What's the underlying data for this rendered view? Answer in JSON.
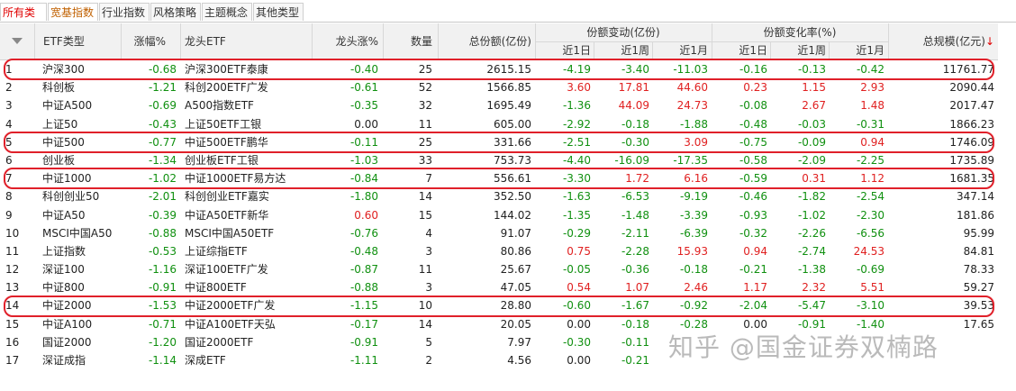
{
  "tabs": [
    {
      "label": "所有类型",
      "state": "active"
    },
    {
      "label": "宽基指数",
      "state": "selected"
    },
    {
      "label": "行业指数",
      "state": ""
    },
    {
      "label": "风格策略",
      "state": ""
    },
    {
      "label": "主题概念",
      "state": ""
    },
    {
      "label": "其他类型",
      "state": ""
    }
  ],
  "columns": {
    "etf_type": "ETF类型",
    "change_pct": "涨幅%",
    "leader_etf": "龙头ETF",
    "leader_change": "龙头涨%",
    "count": "数量",
    "total_shares": "总份额(亿份)",
    "share_change_group": "份额变动(亿份)",
    "share_rate_group": "份额变化率(%)",
    "d1": "近1日",
    "w1": "近1周",
    "m1": "近1月",
    "total_scale": "总规模(亿元)",
    "sort_indicator": "↓"
  },
  "rows": [
    {
      "no": "1",
      "type": "沪深300",
      "chg": "-0.68",
      "etf": "沪深300ETF泰康",
      "lchg": "-0.40",
      "cnt": "25",
      "shares": "2615.15",
      "sd": "-4.19",
      "sw": "-3.40",
      "sm": "-11.03",
      "rd": "-0.16",
      "rw": "-0.13",
      "rm": "-0.42",
      "scale": "11761.77"
    },
    {
      "no": "2",
      "type": "科创板",
      "chg": "-1.21",
      "etf": "科创200ETF广发",
      "lchg": "-0.61",
      "cnt": "52",
      "shares": "1566.85",
      "sd": "3.60",
      "sw": "17.81",
      "sm": "44.60",
      "rd": "0.23",
      "rw": "1.15",
      "rm": "2.93",
      "scale": "2090.44"
    },
    {
      "no": "3",
      "type": "中证A500",
      "chg": "-0.69",
      "etf": "A500指数ETF",
      "lchg": "-0.35",
      "cnt": "32",
      "shares": "1695.49",
      "sd": "-1.36",
      "sw": "44.09",
      "sm": "24.73",
      "rd": "-0.08",
      "rw": "2.67",
      "rm": "1.48",
      "scale": "2017.47"
    },
    {
      "no": "4",
      "type": "上证50",
      "chg": "-0.43",
      "etf": "上证50ETF工银",
      "lchg": "0.00",
      "cnt": "11",
      "shares": "605.00",
      "sd": "-2.92",
      "sw": "-0.18",
      "sm": "-1.88",
      "rd": "-0.48",
      "rw": "-0.03",
      "rm": "-0.31",
      "scale": "1866.23"
    },
    {
      "no": "5",
      "type": "中证500",
      "chg": "-0.77",
      "etf": "中证500ETF鹏华",
      "lchg": "-0.11",
      "cnt": "25",
      "shares": "331.66",
      "sd": "-2.51",
      "sw": "-0.30",
      "sm": "3.09",
      "rd": "-0.75",
      "rw": "-0.09",
      "rm": "0.94",
      "scale": "1746.09"
    },
    {
      "no": "6",
      "type": "创业板",
      "chg": "-1.34",
      "etf": "创业板ETF工银",
      "lchg": "-1.03",
      "cnt": "33",
      "shares": "753.73",
      "sd": "-4.40",
      "sw": "-16.09",
      "sm": "-17.35",
      "rd": "-0.58",
      "rw": "-2.09",
      "rm": "-2.25",
      "scale": "1735.89"
    },
    {
      "no": "7",
      "type": "中证1000",
      "chg": "-1.02",
      "etf": "中证1000ETF易方达",
      "lchg": "-0.84",
      "cnt": "7",
      "shares": "556.61",
      "sd": "-3.30",
      "sw": "1.72",
      "sm": "6.16",
      "rd": "-0.59",
      "rw": "0.31",
      "rm": "1.12",
      "scale": "1681.35"
    },
    {
      "no": "8",
      "type": "科创创业50",
      "chg": "-2.01",
      "etf": "科创创业ETF嘉实",
      "lchg": "-1.80",
      "cnt": "14",
      "shares": "352.50",
      "sd": "-1.63",
      "sw": "-6.53",
      "sm": "-9.19",
      "rd": "-0.46",
      "rw": "-1.82",
      "rm": "-2.54",
      "scale": "347.14"
    },
    {
      "no": "9",
      "type": "中证A50",
      "chg": "-0.39",
      "etf": "中证A50ETF新华",
      "lchg": "0.60",
      "cnt": "15",
      "shares": "144.02",
      "sd": "-1.35",
      "sw": "-1.48",
      "sm": "-3.39",
      "rd": "-0.93",
      "rw": "-1.02",
      "rm": "-2.30",
      "scale": "181.86"
    },
    {
      "no": "10",
      "type": "MSCI中国A50",
      "chg": "-0.88",
      "etf": "MSCI中国A50ETF",
      "lchg": "-0.76",
      "cnt": "4",
      "shares": "91.07",
      "sd": "-0.29",
      "sw": "-2.11",
      "sm": "-6.39",
      "rd": "-0.32",
      "rw": "-2.26",
      "rm": "-6.56",
      "scale": "95.99"
    },
    {
      "no": "11",
      "type": "上证指数",
      "chg": "-0.53",
      "etf": "上证综指ETF",
      "lchg": "-0.48",
      "cnt": "3",
      "shares": "80.86",
      "sd": "0.75",
      "sw": "-2.28",
      "sm": "15.93",
      "rd": "0.94",
      "rw": "-2.74",
      "rm": "24.53",
      "scale": "84.81"
    },
    {
      "no": "12",
      "type": "深证100",
      "chg": "-1.16",
      "etf": "深证100ETF广发",
      "lchg": "-0.87",
      "cnt": "11",
      "shares": "25.67",
      "sd": "-0.05",
      "sw": "-0.36",
      "sm": "-0.18",
      "rd": "-0.21",
      "rw": "-1.38",
      "rm": "-0.69",
      "scale": "78.33"
    },
    {
      "no": "13",
      "type": "中证800",
      "chg": "-0.91",
      "etf": "中证800ETF",
      "lchg": "-0.88",
      "cnt": "3",
      "shares": "47.05",
      "sd": "0.54",
      "sw": "1.07",
      "sm": "2.46",
      "rd": "1.17",
      "rw": "2.32",
      "rm": "5.51",
      "scale": "59.27"
    },
    {
      "no": "14",
      "type": "中证2000",
      "chg": "-1.53",
      "etf": "中证2000ETF广发",
      "lchg": "-1.15",
      "cnt": "10",
      "shares": "28.80",
      "sd": "-0.60",
      "sw": "-1.67",
      "sm": "-0.92",
      "rd": "-2.04",
      "rw": "-5.47",
      "rm": "-3.10",
      "scale": "39.53"
    },
    {
      "no": "15",
      "type": "中证A100",
      "chg": "-0.71",
      "etf": "中证A100ETF天弘",
      "lchg": "-0.17",
      "cnt": "14",
      "shares": "20.05",
      "sd": "0.00",
      "sw": "-0.18",
      "sm": "-0.28",
      "rd": "0.00",
      "rw": "-0.91",
      "rm": "-1.40",
      "scale": "17.65"
    },
    {
      "no": "16",
      "type": "国证2000",
      "chg": "-1.20",
      "etf": "国证2000ETF",
      "lchg": "-0.91",
      "cnt": "5",
      "shares": "7.97",
      "sd": "-0.30",
      "sw": "-0.11",
      "sm": "",
      "rd": "",
      "rw": "",
      "rm": "",
      "scale": ""
    },
    {
      "no": "17",
      "type": "深证成指",
      "chg": "-1.14",
      "etf": "深成ETF",
      "lchg": "-1.11",
      "cnt": "2",
      "shares": "4.56",
      "sd": "0.00",
      "sw": "-0.21",
      "sm": "",
      "rd": "",
      "rw": "",
      "rm": "",
      "scale": ""
    }
  ],
  "highlighted_rows": [
    1,
    5,
    7,
    14
  ],
  "watermark": "知乎 @国金证券双楠路",
  "colors": {
    "up": "#e02020",
    "down": "#109010",
    "highlight": "#e0202a"
  }
}
